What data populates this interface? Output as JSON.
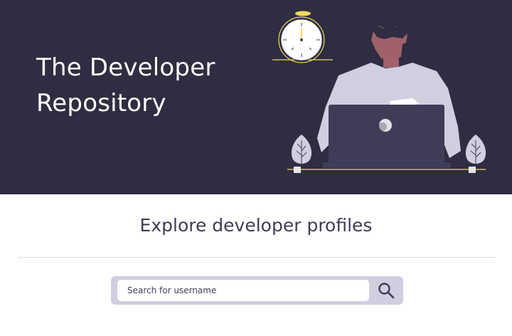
{
  "hero": {
    "title_line_1": "The Developer",
    "title_line_2": "Repository",
    "background_color": "#2f2d41",
    "illustration": "developer-at-laptop",
    "accent_color": "#f0d95b"
  },
  "explore": {
    "heading": "Explore developer profiles"
  },
  "search": {
    "placeholder": "Search for username",
    "value": "",
    "icon": "search-icon",
    "bar_color": "#d1cee0"
  }
}
